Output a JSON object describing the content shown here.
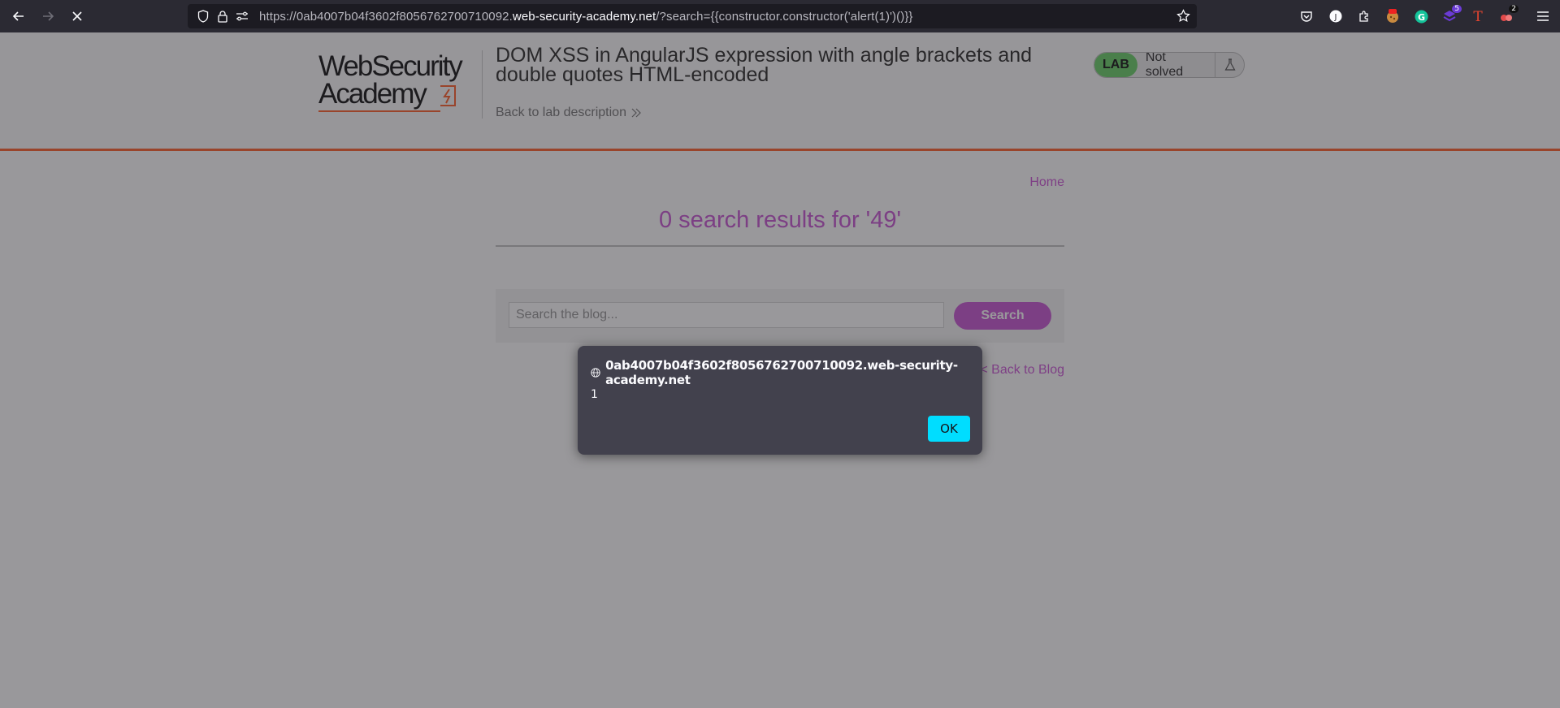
{
  "browser": {
    "url_prefix": "https://0ab4007b04f3602f8056762700710092.",
    "url_host": "web-security-academy.net",
    "url_suffix": "/?search={{constructor.constructor('alert(1)')()}}",
    "extension_badge_1": "5",
    "extension_badge_2": "2"
  },
  "header": {
    "logo_line1": "WebSecurity",
    "logo_line2": "Academy",
    "title": "DOM XSS in AngularJS expression with angle brackets and double quotes HTML-encoded",
    "back_link": "Back to lab description",
    "lab_badge": "LAB",
    "status": "Not solved"
  },
  "content": {
    "home_link": "Home",
    "results_title": "0 search results for '49'",
    "search_placeholder": "Search the blog...",
    "search_button": "Search",
    "back_to_blog": "< Back to Blog"
  },
  "dialog": {
    "origin": "0ab4007b04f3602f8056762700710092.web-security-academy.net",
    "message": "1",
    "ok_label": "OK"
  },
  "colors": {
    "accent_orange": "#ff6633",
    "link_purple": "#ce5ed8",
    "lab_green": "#70d16d",
    "ok_button": "#00ddff"
  }
}
